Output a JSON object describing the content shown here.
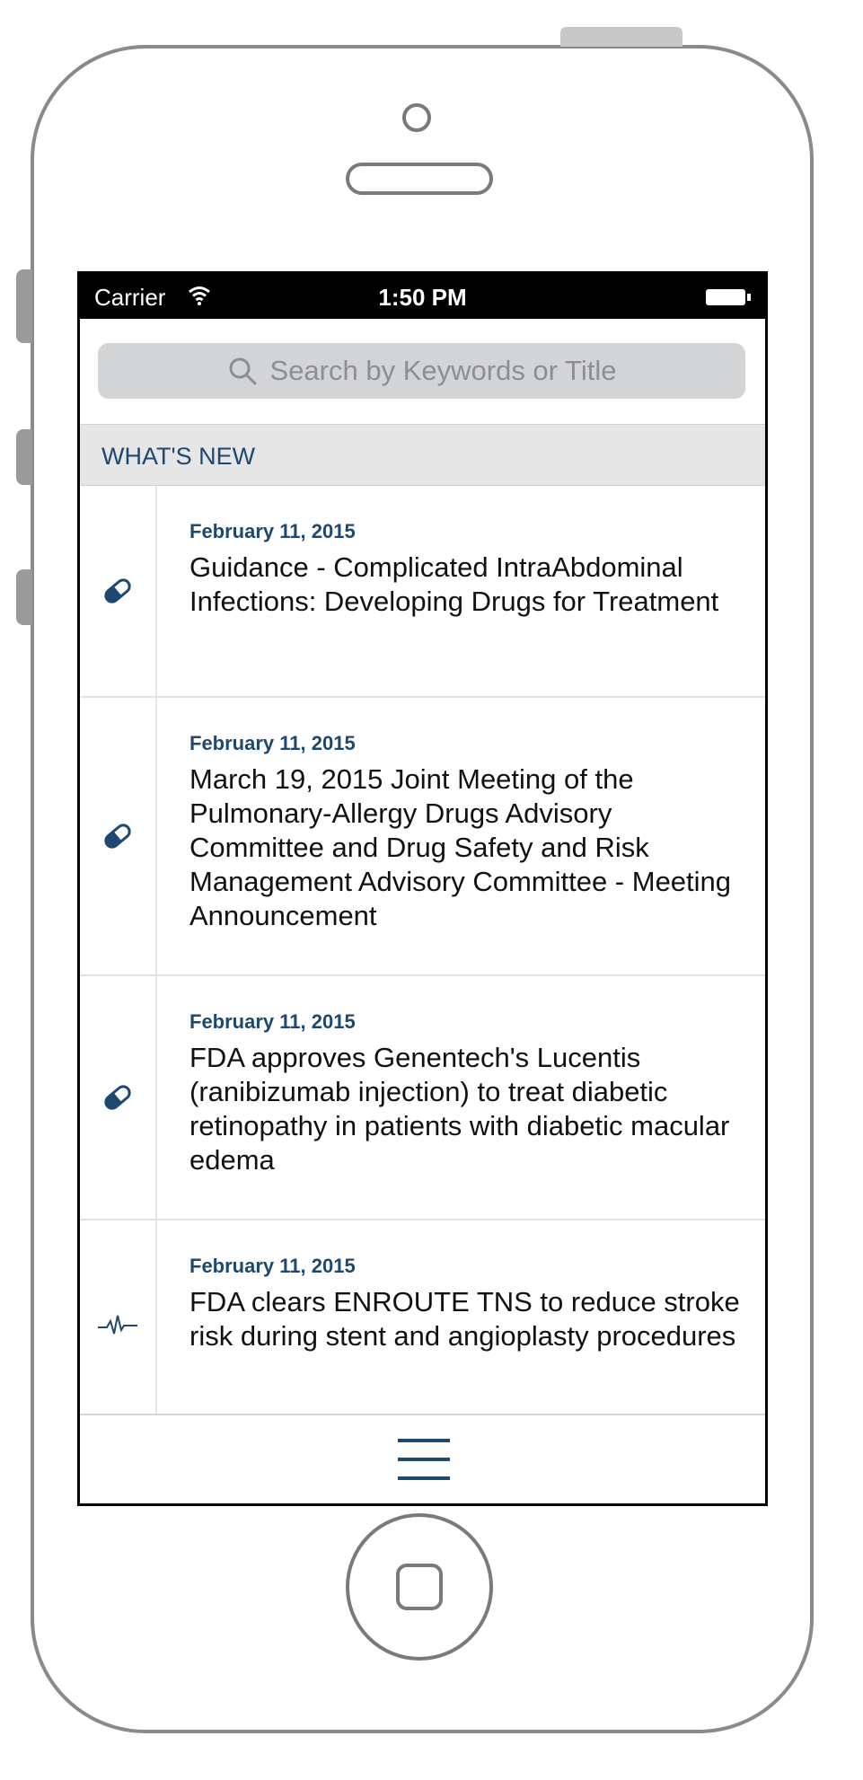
{
  "status_bar": {
    "carrier": "Carrier",
    "time": "1:50 PM"
  },
  "search": {
    "placeholder": "Search by Keywords or Title"
  },
  "section": {
    "title": "WHAT'S NEW"
  },
  "items": [
    {
      "date": "February 11, 2015",
      "title": "Guidance - Complicated IntraAbdominal Infections: Developing Drugs for Treatment",
      "icon": "pill-icon"
    },
    {
      "date": "February 11, 2015",
      "title": "March 19, 2015 Joint Meeting of the Pulmonary-Allergy Drugs Advisory Committee and Drug Safety and Risk Management Advisory Committee - Meeting Announcement",
      "icon": "pill-icon"
    },
    {
      "date": "February 11, 2015",
      "title": "FDA approves Genentech's Lucentis (ranibizumab injection) to treat diabetic retinopathy in patients with diabetic macular edema",
      "icon": "pill-icon"
    },
    {
      "date": "February 11, 2015",
      "title": "FDA clears ENROUTE TNS to reduce stroke risk during stent and angioplasty procedures",
      "icon": "heartbeat-icon"
    }
  ],
  "colors": {
    "accent": "#1e4870",
    "search_bg": "#d3d4d6",
    "header_bg": "#e6e6e6"
  }
}
